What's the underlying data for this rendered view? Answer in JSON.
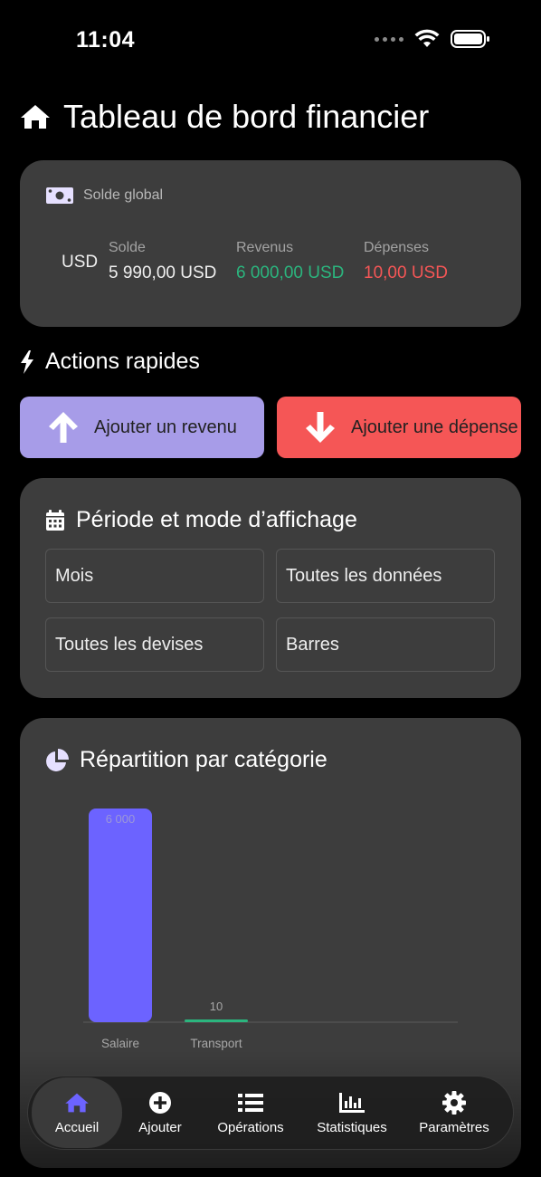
{
  "status": {
    "time": "11:04"
  },
  "header": {
    "title": "Tableau de bord financier",
    "icon": "home-icon"
  },
  "balance": {
    "heading": "Solde global",
    "currency": "USD",
    "solde_label": "Solde",
    "solde_value": "5 990,00 USD",
    "revenus_label": "Revenus",
    "revenus_value": "6 000,00 USD",
    "depenses_label": "Dépenses",
    "depenses_value": "10,00 USD"
  },
  "quick_actions": {
    "title": "Actions rapides",
    "add_income": "Ajouter un revenu",
    "add_expense": "Ajouter une dépense"
  },
  "period": {
    "title": "Période et mode d’affichage",
    "period_select": "Mois",
    "data_select": "Toutes les données",
    "currency_select": "Toutes les devises",
    "mode_select": "Barres"
  },
  "chart_section": {
    "title": "Répartition par catégorie"
  },
  "chart_data": {
    "type": "bar",
    "categories": [
      "Salaire",
      "Transport"
    ],
    "values": [
      6000,
      10
    ],
    "value_labels": [
      "6 000",
      "10"
    ],
    "colors": [
      "#6c63ff",
      "#2bb57e"
    ],
    "title": "",
    "xlabel": "",
    "ylabel": "",
    "ylim": [
      0,
      6000
    ],
    "grid": false,
    "legend": "none"
  },
  "tabs": [
    {
      "label": "Accueil",
      "icon": "home-icon",
      "active": true
    },
    {
      "label": "Ajouter",
      "icon": "plus-circle-icon",
      "active": false
    },
    {
      "label": "Opérations",
      "icon": "list-icon",
      "active": false
    },
    {
      "label": "Statistiques",
      "icon": "bar-chart-icon",
      "active": false
    },
    {
      "label": "Paramètres",
      "icon": "gear-icon",
      "active": false
    }
  ],
  "colors": {
    "income": "#2bb57e",
    "expense": "#f55656",
    "accent": "#6c63ff",
    "card": "#3d3d3d"
  }
}
